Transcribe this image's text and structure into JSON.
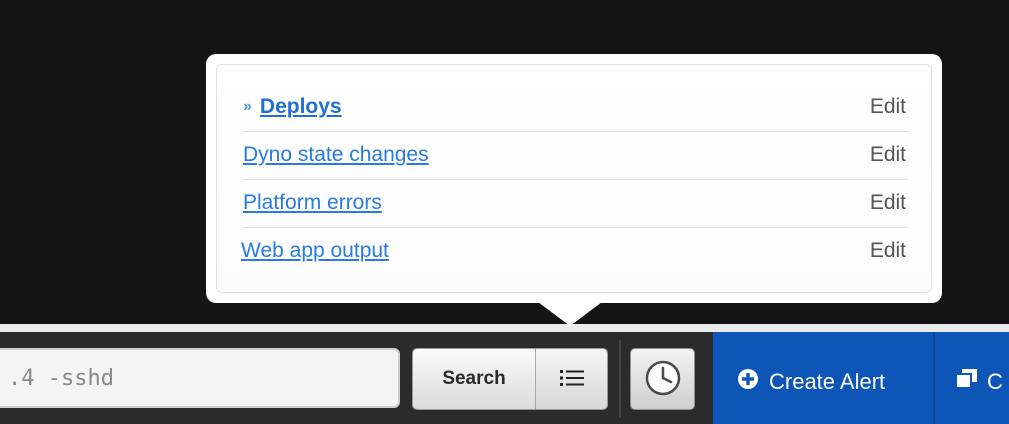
{
  "saved_searches": {
    "items": [
      {
        "label": "Deploys",
        "edit": "Edit",
        "marker": "»"
      },
      {
        "label": "Dyno state changes",
        "edit": "Edit"
      },
      {
        "label": "Platform errors",
        "edit": "Edit"
      },
      {
        "label": "Web app output",
        "edit": "Edit"
      }
    ]
  },
  "toolbar": {
    "search_value": ".4 -sshd",
    "search_button": "Search",
    "list_icon": "list-icon",
    "clock_icon": "clock-icon",
    "create_alert": "Create Alert",
    "copy_partial": "C"
  },
  "colors": {
    "accent_blue": "#0d56b8",
    "link": "#2a7be0",
    "background": "#141414",
    "toolbar": "#2b2b2b"
  }
}
